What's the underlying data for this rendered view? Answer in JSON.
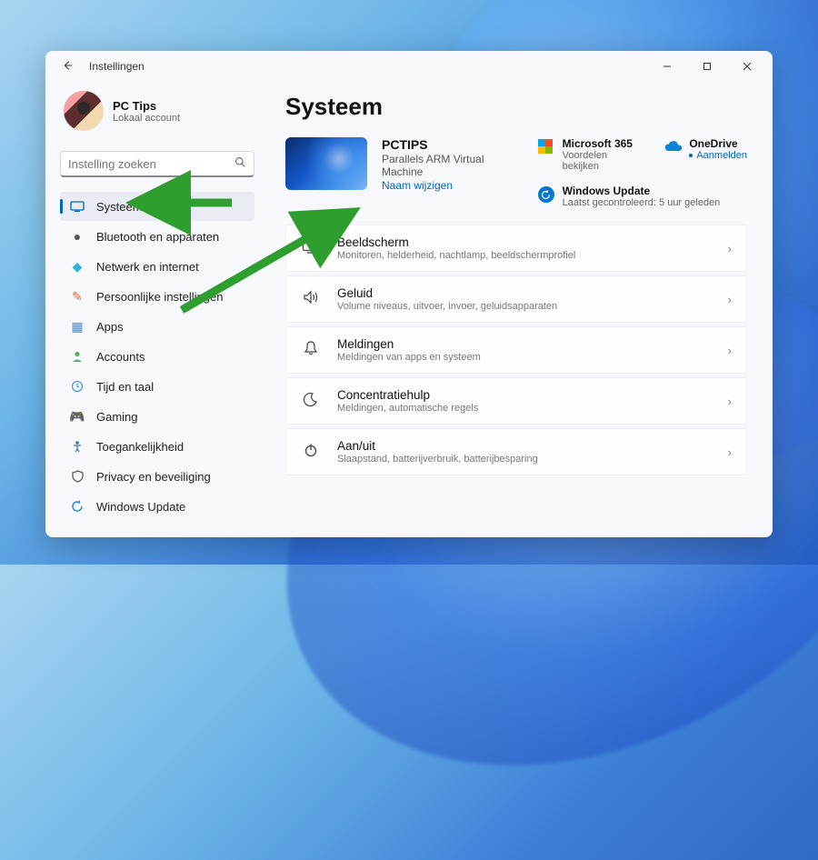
{
  "window": {
    "back_icon": "back",
    "title": "Instellingen"
  },
  "profile": {
    "name": "PC Tips",
    "account_type": "Lokaal account"
  },
  "search": {
    "placeholder": "Instelling zoeken"
  },
  "sidebar": {
    "items": [
      {
        "label": "Systeem",
        "icon": "system",
        "active": true
      },
      {
        "label": "Bluetooth en apparaten",
        "icon": "bluetooth"
      },
      {
        "label": "Netwerk en internet",
        "icon": "network"
      },
      {
        "label": "Persoonlijke instellingen",
        "icon": "personalize"
      },
      {
        "label": "Apps",
        "icon": "apps"
      },
      {
        "label": "Accounts",
        "icon": "accounts"
      },
      {
        "label": "Tijd en taal",
        "icon": "time"
      },
      {
        "label": "Gaming",
        "icon": "gaming"
      },
      {
        "label": "Toegankelijkheid",
        "icon": "accessibility"
      },
      {
        "label": "Privacy en beveiliging",
        "icon": "privacy"
      },
      {
        "label": "Windows Update",
        "icon": "update"
      }
    ]
  },
  "main": {
    "heading": "Systeem",
    "device": {
      "name": "PCTIPS",
      "model": "Parallels ARM Virtual Machine",
      "rename_link": "Naam wijzigen"
    },
    "hero": {
      "ms365": {
        "title": "Microsoft 365",
        "sub": "Voordelen bekijken"
      },
      "onedrive": {
        "title": "OneDrive",
        "sub": "Aanmelden"
      },
      "update": {
        "title": "Windows Update",
        "sub": "Laatst gecontroleerd: 5 uur geleden"
      }
    },
    "cards": [
      {
        "title": "Beeldscherm",
        "sub": "Monitoren, helderheid, nachtlamp, beeldschermprofiel",
        "icon": "display"
      },
      {
        "title": "Geluid",
        "sub": "Volume niveaus, uitvoer, invoer, geluidsapparaten",
        "icon": "sound"
      },
      {
        "title": "Meldingen",
        "sub": "Meldingen van apps en systeem",
        "icon": "notifications"
      },
      {
        "title": "Concentratiehulp",
        "sub": "Meldingen, automatische regels",
        "icon": "focus"
      },
      {
        "title": "Aan/uit",
        "sub": "Slaapstand, batterijverbruik, batterijbesparing",
        "icon": "power"
      }
    ]
  }
}
